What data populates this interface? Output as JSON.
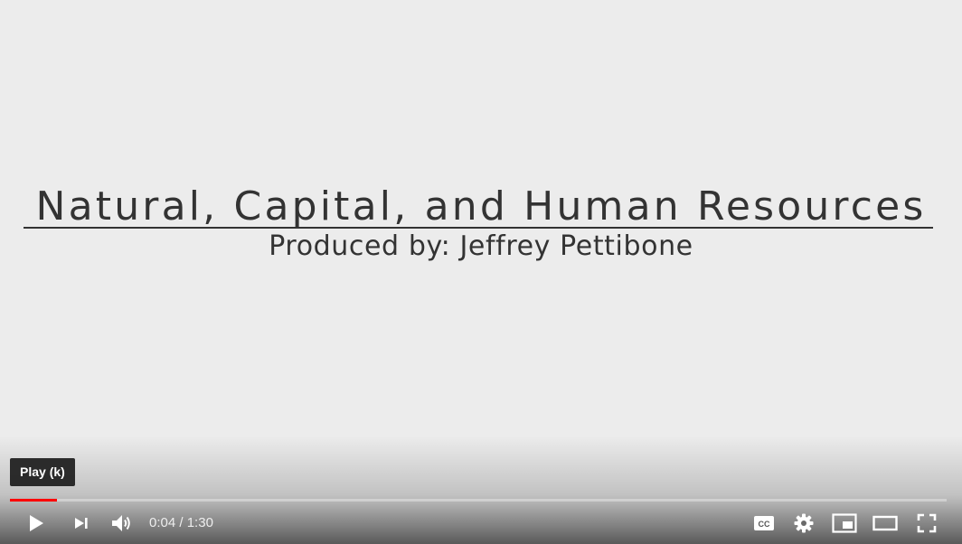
{
  "video": {
    "title_slide": "Natural, Capital, and Human Resources",
    "subtitle_slide": "Produced by: Jeffrey Pettibone"
  },
  "player": {
    "tooltip": "Play (k)",
    "current_time": "0:04",
    "time_separator": " / ",
    "duration": "1:30",
    "progress_fraction": 0.05,
    "accent_color": "#ff0000"
  },
  "icons": {
    "play": "play-icon",
    "next": "next-icon",
    "volume": "volume-icon",
    "captions": "captions-icon",
    "settings": "settings-icon",
    "miniplayer": "miniplayer-icon",
    "theater": "theater-icon",
    "fullscreen": "fullscreen-icon"
  }
}
